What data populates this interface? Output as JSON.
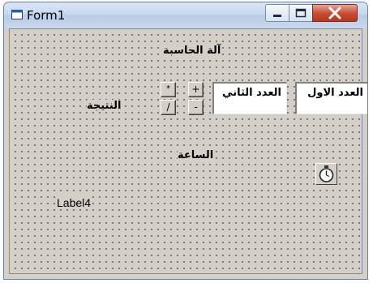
{
  "window": {
    "title": "Form1"
  },
  "labels": {
    "calculator_title": "آلة الحاسبة",
    "result": "النتيجة",
    "clock": "الساعة",
    "label4": "Label4"
  },
  "textboxes": {
    "first_number": "العدد الاول",
    "second_number": "العدد الثاني"
  },
  "operators": {
    "multiply": "*",
    "divide": "/",
    "add": "+",
    "subtract": "-"
  },
  "icons": {
    "app": "form-icon",
    "timer": "stopwatch-icon"
  }
}
